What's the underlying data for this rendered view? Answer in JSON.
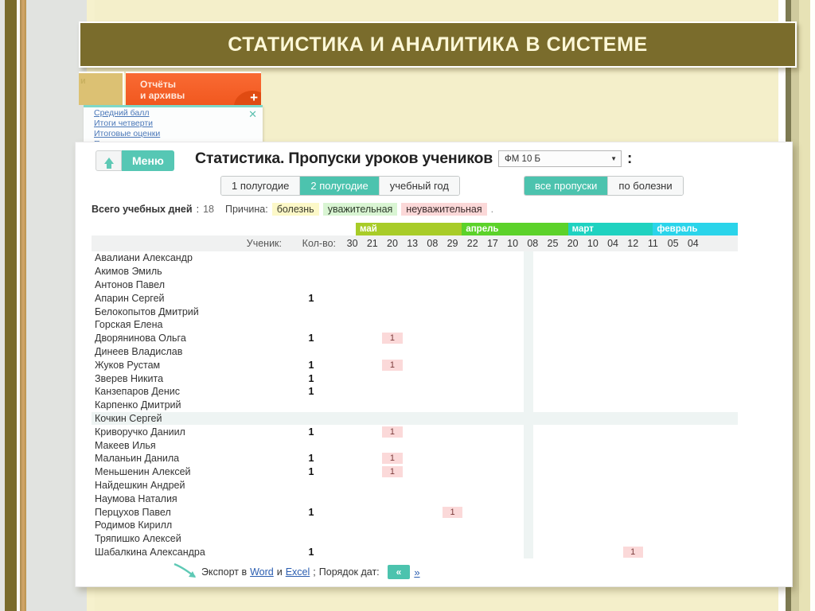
{
  "slide": {
    "banner_title": "СТАТИСТИКА И АНАЛИТИКА В СИСТЕМЕ",
    "banner_color": "#7a6c2c",
    "background_color": "#f4efca"
  },
  "tabs": {
    "gold_label": "и",
    "orange_label": "Отчёты\nи архивы",
    "plus_label": "+"
  },
  "dropdown": {
    "close_icon": "✕",
    "items": [
      {
        "label": "Средний балл"
      },
      {
        "label": "Итоги четверти"
      },
      {
        "label": "Итоговые оценки"
      },
      {
        "label": "Пропуски"
      }
    ]
  },
  "app": {
    "home_button": "home-icon",
    "menu_button": "Меню",
    "page_title": "Статистика. Пропуски уроков учеников",
    "title_colon": ":",
    "class_select": {
      "value": "ФМ 10 Б",
      "caret": "▼"
    },
    "period_tabs": [
      {
        "label": "1 полугодие",
        "active": false
      },
      {
        "label": "2 полугодие",
        "active": true
      },
      {
        "label": "учебный год",
        "active": false
      }
    ],
    "filter_tabs": [
      {
        "label": "все пропуски",
        "active": true
      },
      {
        "label": "по болезни",
        "active": false
      }
    ],
    "info": {
      "total_label": "Всего учебных дней",
      "total_sep": ":",
      "total_days": "18",
      "reason_label": "Причина:",
      "reasons": [
        {
          "label": "болезнь",
          "color": "#fcf8c8"
        },
        {
          "label": "уважительная",
          "color": "#d9f5d3"
        },
        {
          "label": "неуважительная",
          "color": "#fbd8d8"
        }
      ],
      "trailing_dot": "."
    },
    "footer": {
      "export_prefix": "Экспорт в",
      "word_link": "Word",
      "and": "и",
      "excel_link": "Excel",
      "semicolon": ";",
      "order_label": "Порядок дат:",
      "order_desc": "«",
      "order_asc": "»"
    }
  },
  "chart_data": {
    "type": "table",
    "title": "Статистика. Пропуски уроков учеников",
    "headers": {
      "student": "Ученик:",
      "count": "Кол-во:"
    },
    "months": [
      {
        "name": "май",
        "color": "#a8cc28",
        "span": 5
      },
      {
        "name": "апрель",
        "color": "#5cd22a",
        "span": 5
      },
      {
        "name": "март",
        "color": "#1fd2c0",
        "span": 4
      },
      {
        "name": "февраль",
        "color": "#2ad4ea",
        "span": 4
      }
    ],
    "dates": [
      "30",
      "21",
      "20",
      "13",
      "08",
      "29",
      "22",
      "17",
      "10",
      "08",
      "25",
      "20",
      "10",
      "04",
      "12",
      "11",
      "05",
      "04"
    ],
    "rows": [
      {
        "name": "Авалиани Александр",
        "count": "",
        "days": []
      },
      {
        "name": "Акимов Эмиль",
        "count": "",
        "days": []
      },
      {
        "name": "Антонов Павел",
        "count": "",
        "days": []
      },
      {
        "name": "Апарин Сергей",
        "count": "1",
        "days": []
      },
      {
        "name": "Белокопытов Дмитрий",
        "count": "",
        "days": []
      },
      {
        "name": "Горская Елена",
        "count": "",
        "days": []
      },
      {
        "name": "Дворянинова Ольга",
        "count": "1",
        "days": [
          {
            "index": 2,
            "value": "1"
          }
        ]
      },
      {
        "name": "Динеев Владислав",
        "count": "",
        "days": []
      },
      {
        "name": "Жуков Рустам",
        "count": "1",
        "days": [
          {
            "index": 2,
            "value": "1"
          }
        ]
      },
      {
        "name": "Зверев Никита",
        "count": "1",
        "days": []
      },
      {
        "name": "Канзепаров Денис",
        "count": "1",
        "days": []
      },
      {
        "name": "Карпенко Дмитрий",
        "count": "",
        "days": []
      },
      {
        "name": "Кочкин Сергей",
        "count": "",
        "days": [],
        "highlight": true
      },
      {
        "name": "Криворучко Даниил",
        "count": "1",
        "days": [
          {
            "index": 2,
            "value": "1"
          }
        ]
      },
      {
        "name": "Макеев Илья",
        "count": "",
        "days": []
      },
      {
        "name": "Маланьин Данила",
        "count": "1",
        "days": [
          {
            "index": 2,
            "value": "1"
          }
        ]
      },
      {
        "name": "Меньшенин Алексей",
        "count": "1",
        "days": [
          {
            "index": 2,
            "value": "1"
          }
        ]
      },
      {
        "name": "Найдешкин Андрей",
        "count": "",
        "days": []
      },
      {
        "name": "Наумова Наталия",
        "count": "",
        "days": []
      },
      {
        "name": "Перцухов Павел",
        "count": "1",
        "days": [
          {
            "index": 5,
            "value": "1"
          }
        ]
      },
      {
        "name": "Родимов Кирилл",
        "count": "",
        "days": []
      },
      {
        "name": "Тряпишко Алексей",
        "count": "",
        "days": []
      },
      {
        "name": "Шабалкина Александра",
        "count": "1",
        "days": [
          {
            "index": 14,
            "value": "1"
          }
        ]
      }
    ]
  }
}
